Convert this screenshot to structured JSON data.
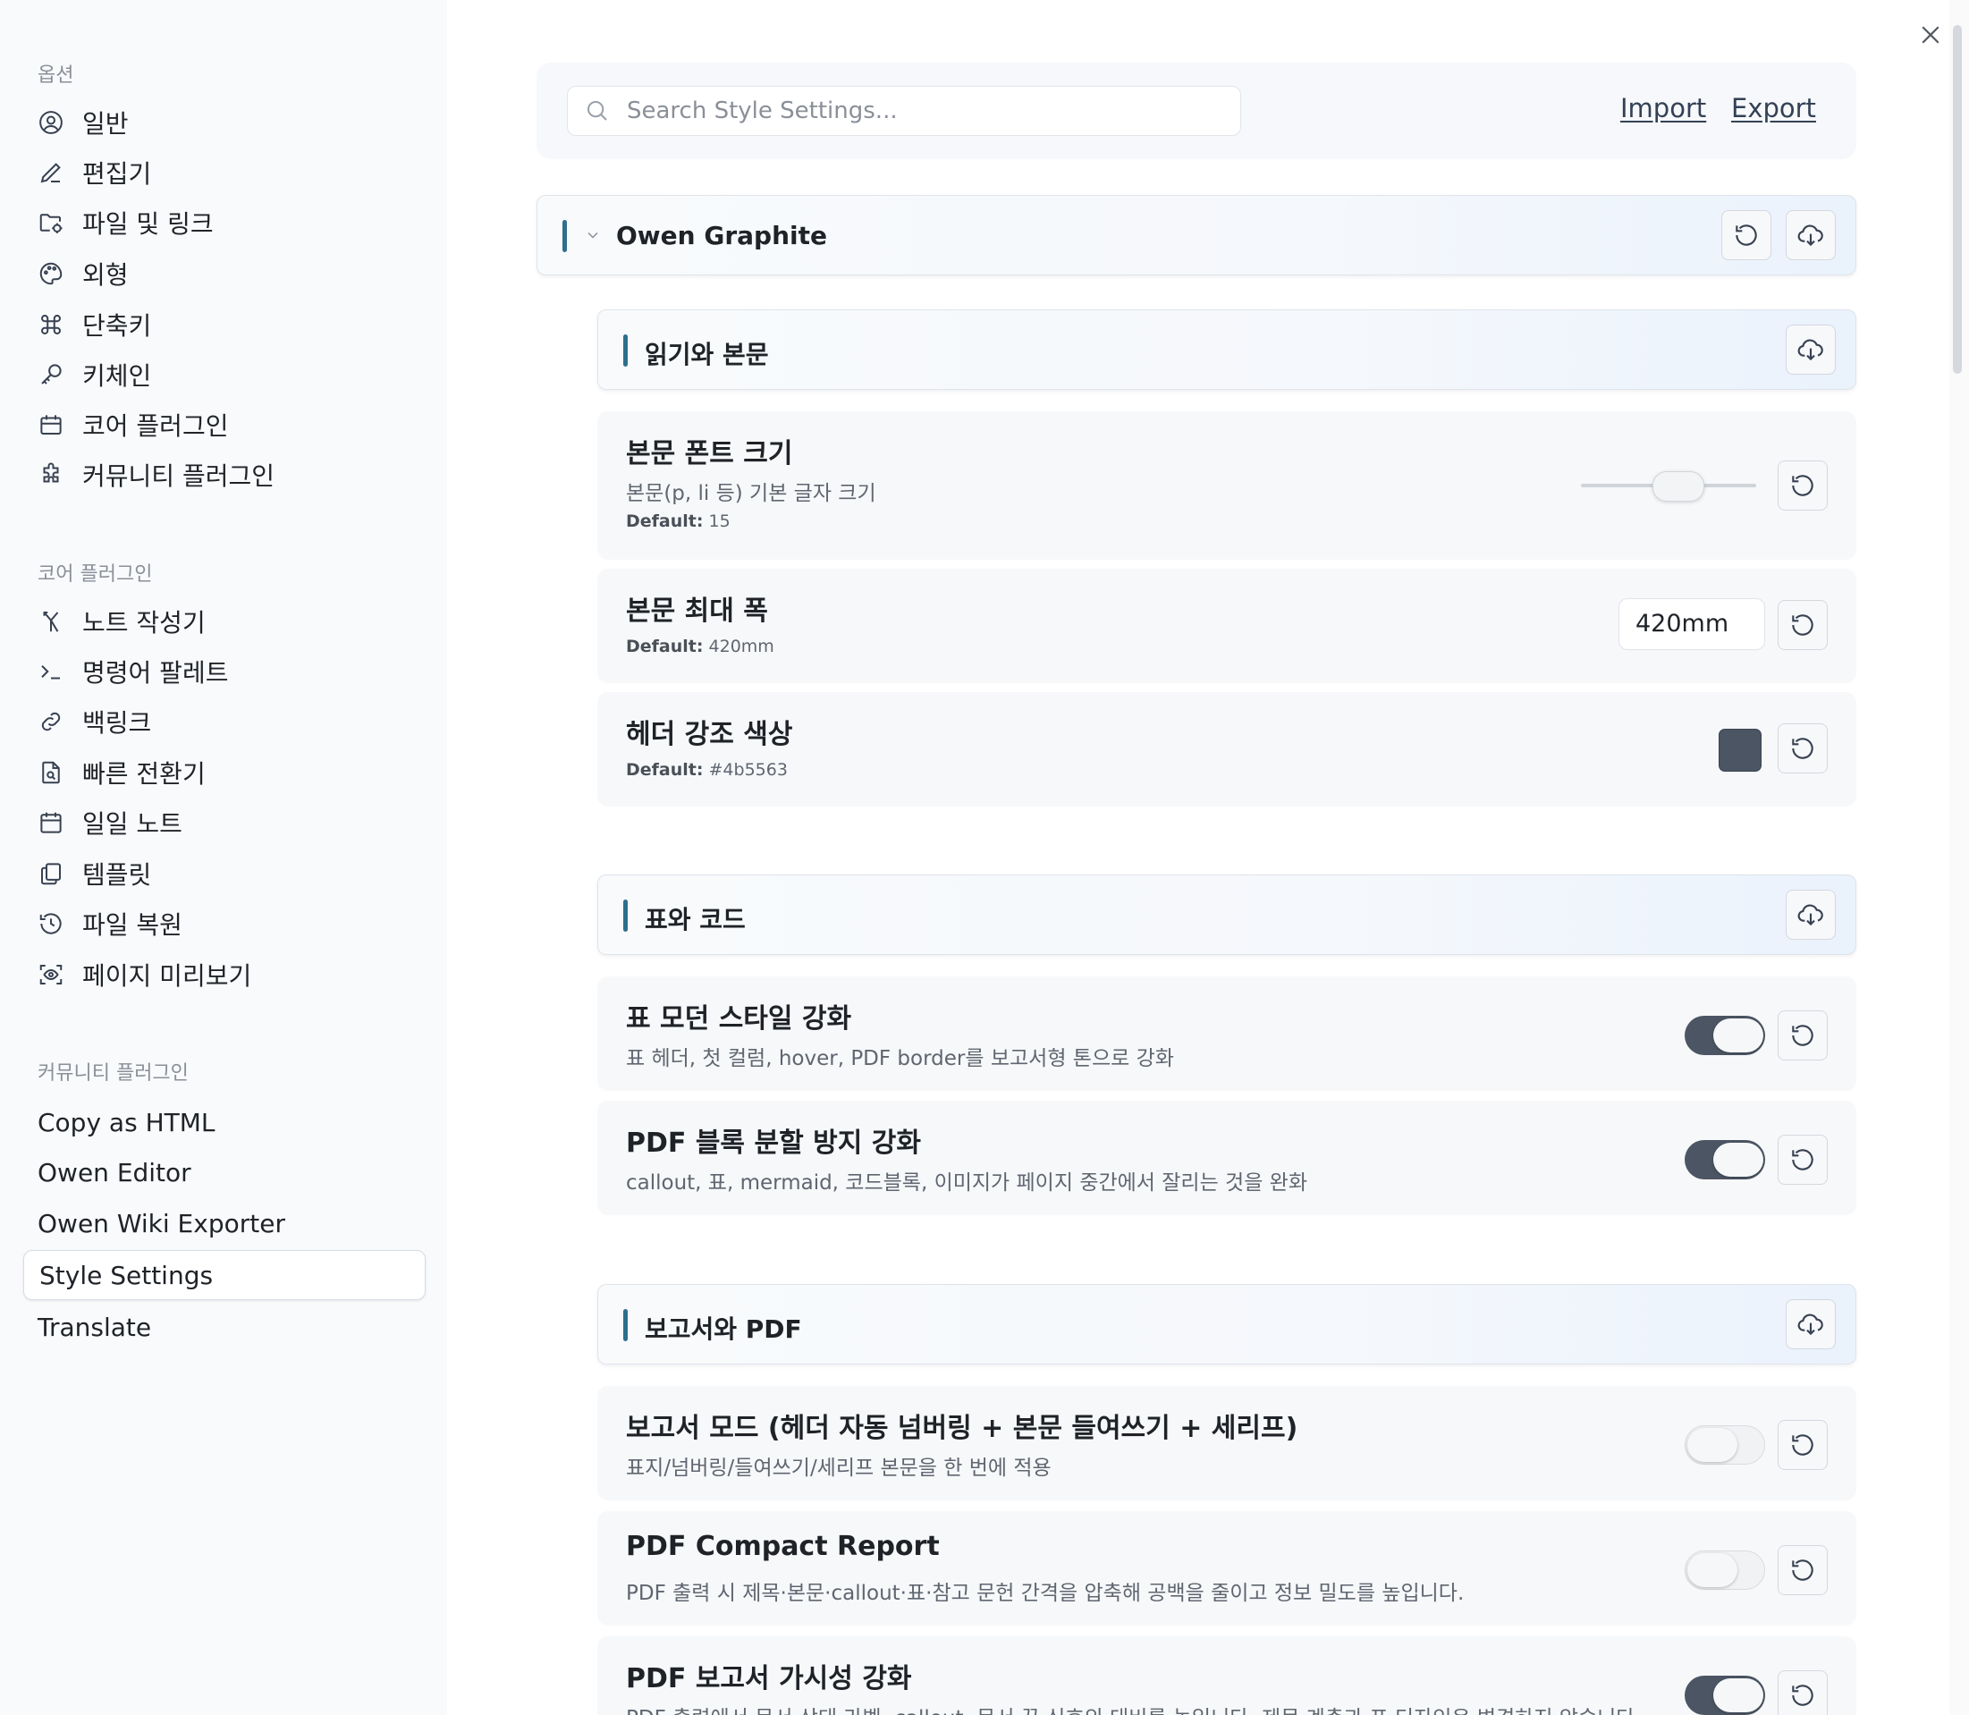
{
  "sidebar": {
    "options_heading": "옵션",
    "options_items": [
      {
        "label": "일반",
        "icon": "user-circle-icon"
      },
      {
        "label": "편집기",
        "icon": "pencil-icon"
      },
      {
        "label": "파일 및 링크",
        "icon": "folder-gear-icon"
      },
      {
        "label": "외형",
        "icon": "palette-icon"
      },
      {
        "label": "단축키",
        "icon": "command-key-icon"
      },
      {
        "label": "키체인",
        "icon": "key-icon"
      },
      {
        "label": "코어 플러그인",
        "icon": "calendar-box-icon"
      },
      {
        "label": "커뮤니티 플러그인",
        "icon": "puzzle-icon"
      }
    ],
    "core_heading": "코어 플러그인",
    "core_items": [
      {
        "label": "노트 작성기",
        "icon": "merge-arrow-icon"
      },
      {
        "label": "명령어 팔레트",
        "icon": "terminal-icon"
      },
      {
        "label": "백링크",
        "icon": "link-icon"
      },
      {
        "label": "빠른 전환기",
        "icon": "file-search-icon"
      },
      {
        "label": "일일 노트",
        "icon": "calendar-icon"
      },
      {
        "label": "템플릿",
        "icon": "copy-file-icon"
      },
      {
        "label": "파일 복원",
        "icon": "history-icon"
      },
      {
        "label": "페이지 미리보기",
        "icon": "eye-scan-icon"
      }
    ],
    "community_heading": "커뮤니티 플러그인",
    "community_items": [
      {
        "label": "Copy as HTML"
      },
      {
        "label": "Owen Editor"
      },
      {
        "label": "Owen Wiki Exporter"
      },
      {
        "label": "Style Settings",
        "active": true
      },
      {
        "label": "Translate"
      }
    ]
  },
  "search": {
    "placeholder": "Search Style Settings...",
    "value": ""
  },
  "top_links": {
    "import": "Import",
    "export": "Export"
  },
  "theme_section": {
    "title": "Owen Graphite"
  },
  "sections": [
    {
      "title": "읽기와 본문",
      "settings": [
        {
          "name": "본문 폰트 크기",
          "desc": "본문(p, li 등) 기본 글자 크기",
          "default_label": "Default:",
          "default_value": "15",
          "control": "slider"
        },
        {
          "name": "본문 최대 폭",
          "default_label": "Default:",
          "default_value": "420mm",
          "control": "input",
          "value": "420mm"
        },
        {
          "name": "헤더 강조 색상",
          "default_label": "Default:",
          "default_value": "#4b5563",
          "control": "color",
          "value": "#4b5563"
        }
      ]
    },
    {
      "title": "표와 코드",
      "settings": [
        {
          "name": "표 모던 스타일 강화",
          "desc": "표 헤더, 첫 컬럼, hover, PDF border를 보고서형 톤으로 강화",
          "control": "toggle",
          "on": true
        },
        {
          "name": "PDF 블록 분할 방지 강화",
          "desc": "callout, 표, mermaid, 코드블록, 이미지가 페이지 중간에서 잘리는 것을 완화",
          "control": "toggle",
          "on": true
        }
      ]
    },
    {
      "title": "보고서와 PDF",
      "settings": [
        {
          "name": "보고서 모드 (헤더 자동 넘버링 + 본문 들여쓰기 + 세리프)",
          "desc": "표지/넘버링/들여쓰기/세리프 본문을 한 번에 적용",
          "control": "toggle",
          "on": false
        },
        {
          "name": "PDF Compact Report",
          "desc": "PDF 출력 시 제목·본문·callout·표·참고 문헌 간격을 압축해 공백을 줄이고 정보 밀도를 높입니다.",
          "control": "toggle",
          "on": false
        },
        {
          "name": "PDF 보고서 가시성 강화",
          "desc": "PDF 출력에서 문서 상태 라벨, callout, 문서 끝 신호의 대비를 높입니다. 제목 계층과 표 디자인은 변경하지 않습니다.",
          "control": "toggle",
          "on": true
        }
      ]
    }
  ],
  "slider": {
    "value": 15,
    "fraction": 0.55
  },
  "colors": {
    "accent_bar": "#2e6f8e",
    "toggle_on": "#4b5563",
    "swatch": "#4b5563"
  }
}
